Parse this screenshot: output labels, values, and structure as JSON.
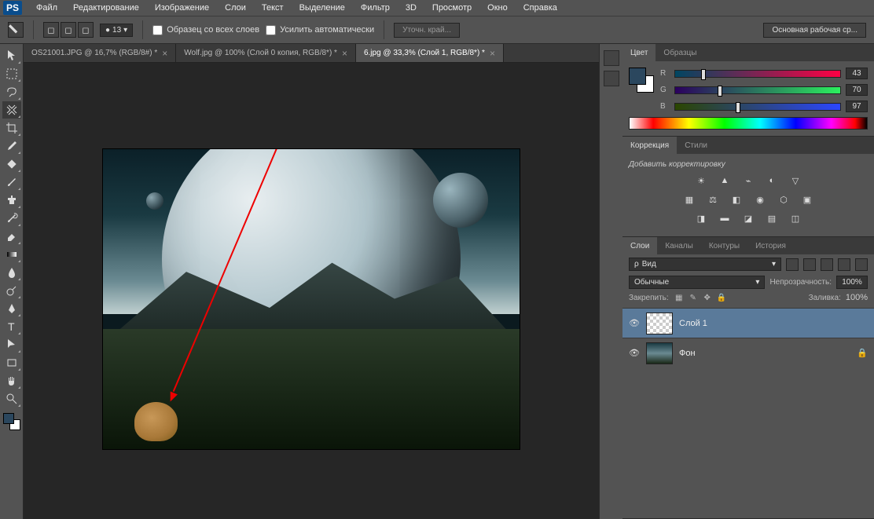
{
  "app": {
    "logo": "PS"
  },
  "menubar": [
    "Файл",
    "Редактирование",
    "Изображение",
    "Слои",
    "Текст",
    "Выделение",
    "Фильтр",
    "3D",
    "Просмотр",
    "Окно",
    "Справка"
  ],
  "options_bar": {
    "brush_size": "13",
    "sample_all_layers": "Образец со всех слоев",
    "content_aware": "Усилить автоматически",
    "refine_edge": "Уточн. край...",
    "workspace": "Основная рабочая ср..."
  },
  "tabs": [
    {
      "label": "OS21001.JPG @ 16,7% (RGB/8#) *",
      "active": false
    },
    {
      "label": "Wolf.jpg @ 100% (Слой 0 копия, RGB/8*) *",
      "active": false
    },
    {
      "label": "6.jpg @ 33,3% (Слой 1, RGB/8*) *",
      "active": true
    }
  ],
  "tools": [
    "move",
    "marquee",
    "lasso",
    "quick-select",
    "crop",
    "eyedropper",
    "spot-heal",
    "brush",
    "clone",
    "history-brush",
    "eraser",
    "gradient",
    "blur",
    "dodge",
    "pen",
    "type",
    "path-select",
    "rectangle",
    "hand",
    "zoom"
  ],
  "color_panel": {
    "tabs": [
      "Цвет",
      "Образцы"
    ],
    "channels": [
      {
        "lbl": "R",
        "val": "43"
      },
      {
        "lbl": "G",
        "val": "70"
      },
      {
        "lbl": "B",
        "val": "97"
      }
    ]
  },
  "adjustments_panel": {
    "tabs": [
      "Коррекция",
      "Стили"
    ],
    "add_label": "Добавить корректировку"
  },
  "layers_panel": {
    "tabs": [
      "Слои",
      "Каналы",
      "Контуры",
      "История"
    ],
    "search_placeholder": "Вид",
    "search_icon_label": "ρ",
    "blend_mode": "Обычные",
    "opacity_label": "Непрозрачность:",
    "opacity_value": "100%",
    "lock_label": "Закрепить:",
    "fill_label": "Заливка:",
    "fill_value": "100%",
    "layers": [
      {
        "name": "Слой 1",
        "visible": true,
        "active": true,
        "thumb": "checker"
      },
      {
        "name": "Фон",
        "visible": true,
        "active": false,
        "thumb": "bg",
        "locked": true
      }
    ]
  }
}
